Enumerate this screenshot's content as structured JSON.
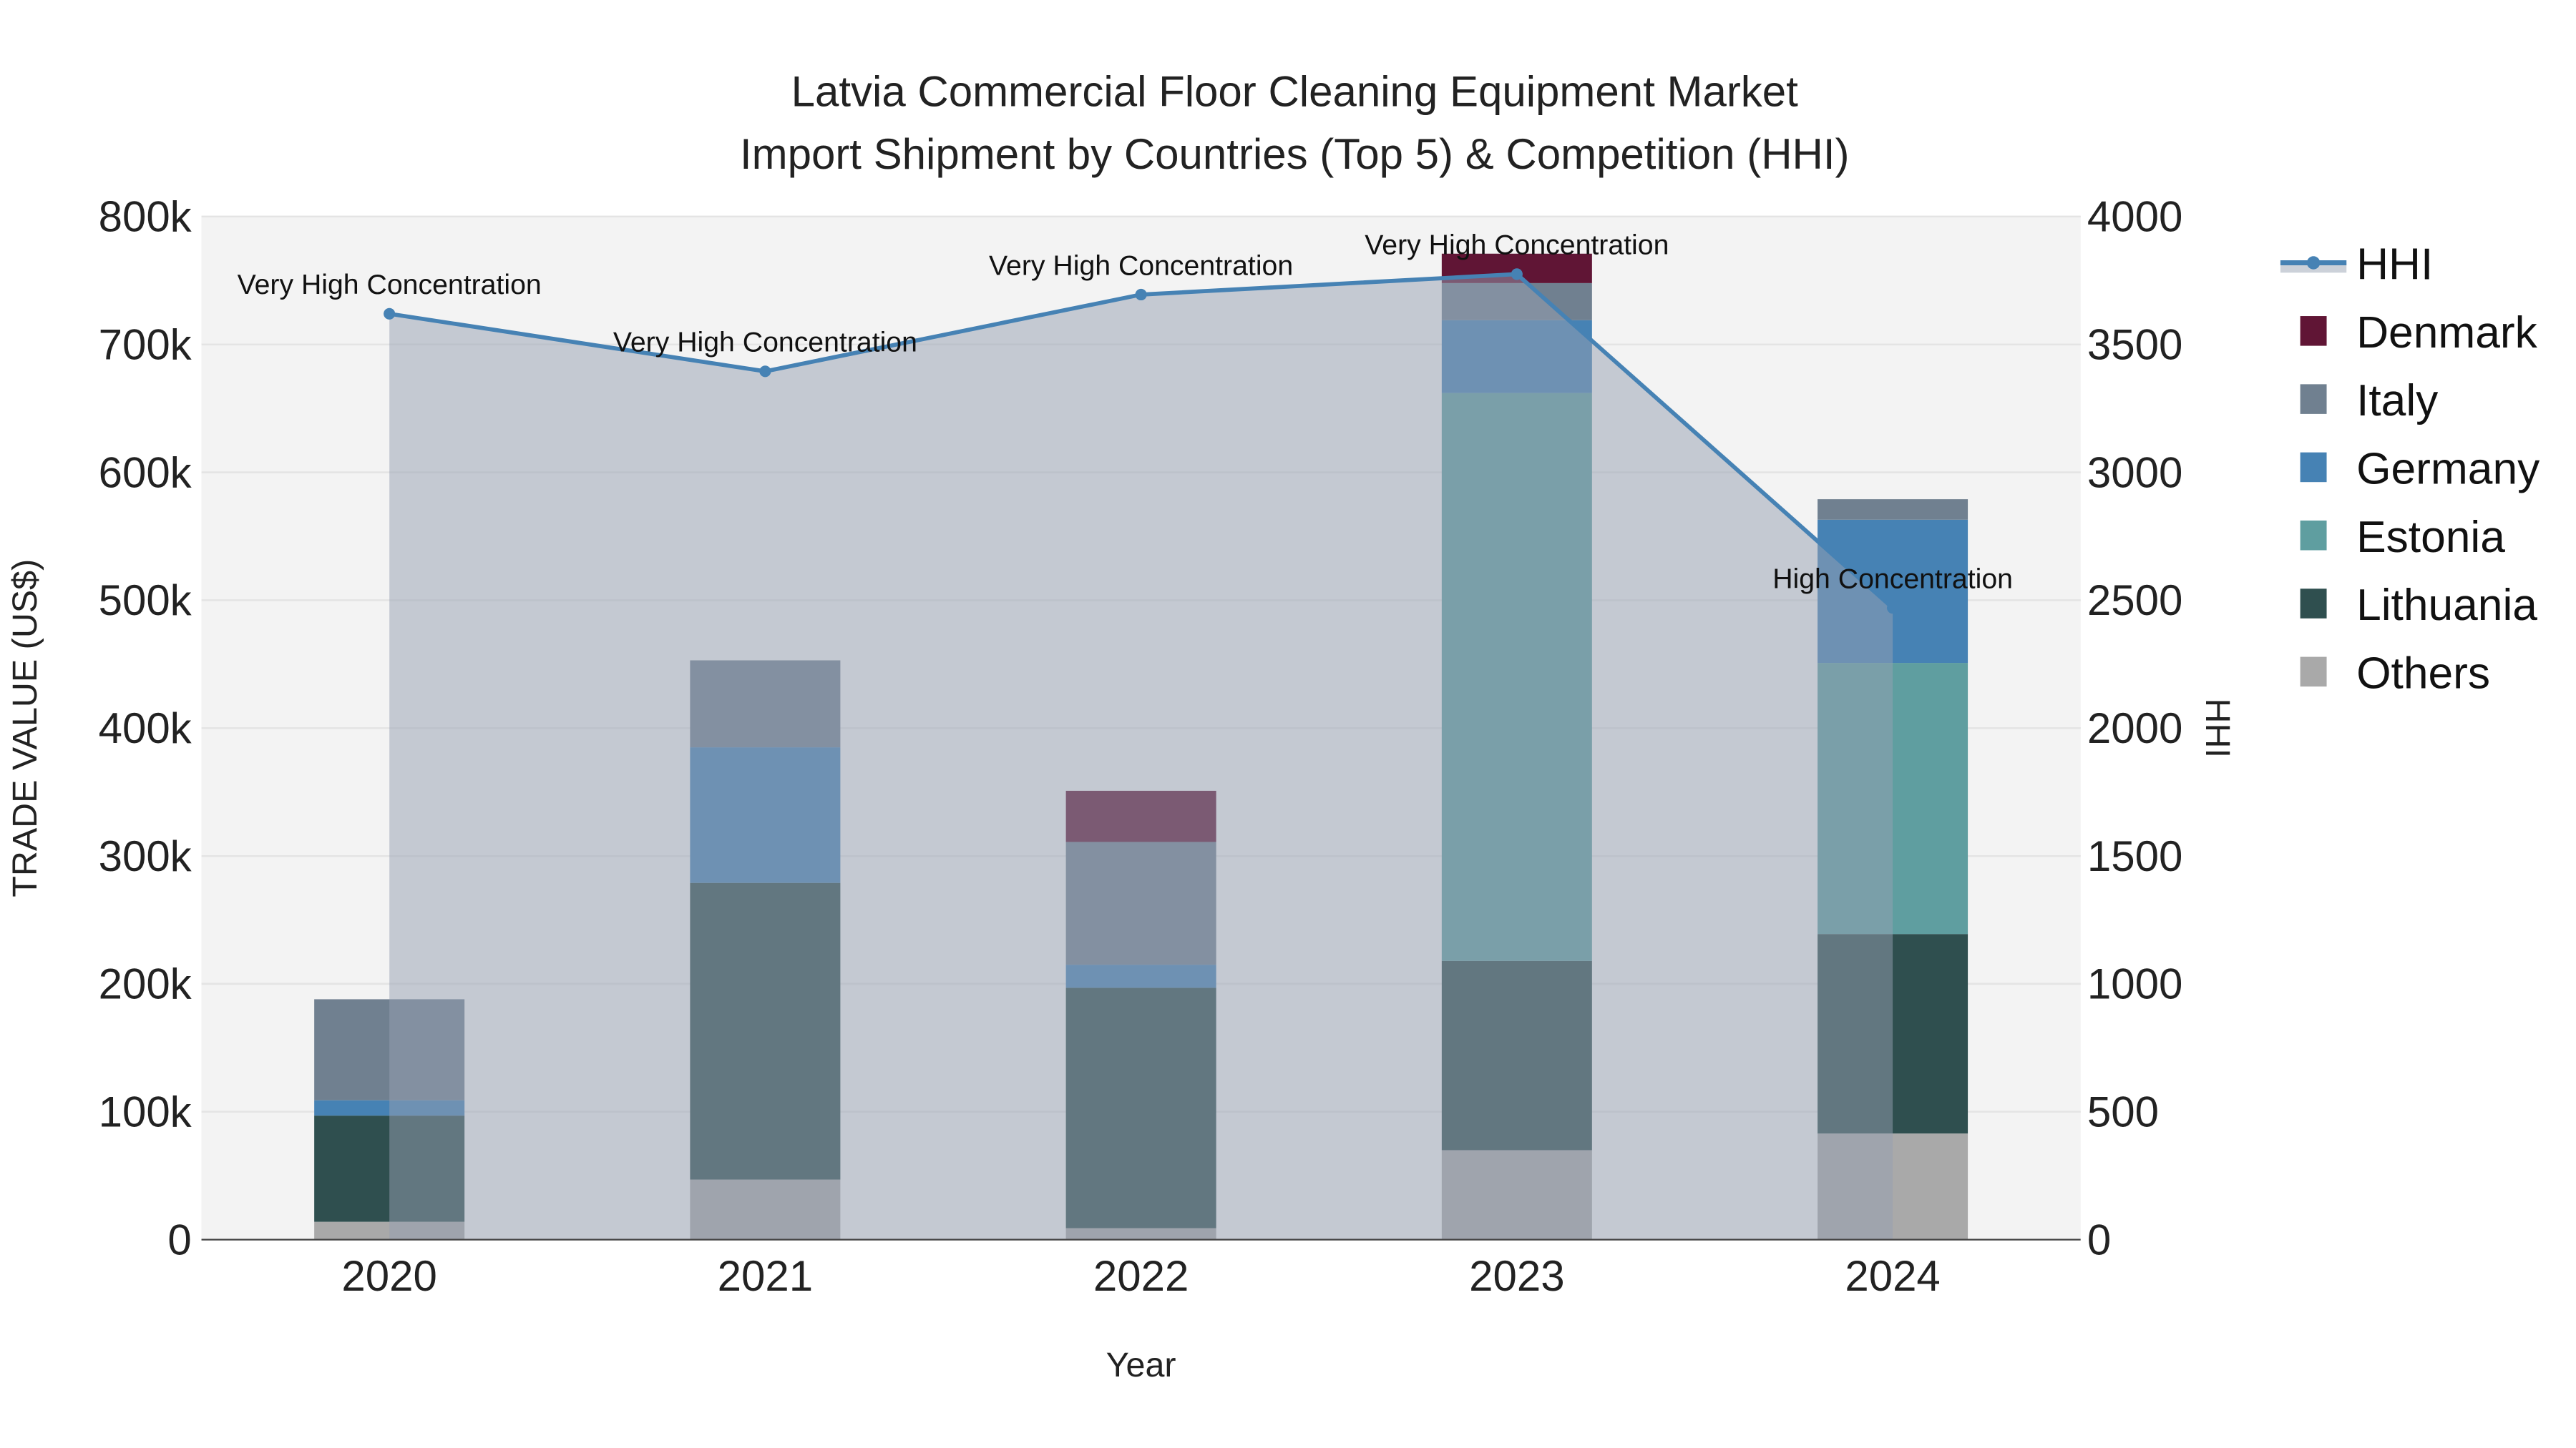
{
  "chart_data": {
    "type": "bar",
    "stacked": true,
    "title": "Latvia Commercial Floor Cleaning Equipment Market",
    "subtitle": "Import Shipment by Countries (Top 5) & Competition (HHI)",
    "xlabel": "Year",
    "ylabel": "TRADE VALUE (US$)",
    "y2label": "HHI",
    "categories": [
      "2020",
      "2021",
      "2022",
      "2023",
      "2024"
    ],
    "ylim": [
      0,
      800000
    ],
    "y2lim": [
      0,
      4000
    ],
    "yticks": [
      0,
      100000,
      200000,
      300000,
      400000,
      500000,
      600000,
      700000,
      800000
    ],
    "ytick_labels": [
      "0",
      "100k",
      "200k",
      "300k",
      "400k",
      "500k",
      "600k",
      "700k",
      "800k"
    ],
    "y2ticks": [
      0,
      500,
      1000,
      1500,
      2000,
      2500,
      3000,
      3500,
      4000
    ],
    "y2tick_labels": [
      "0",
      "500",
      "1000",
      "1500",
      "2000",
      "2500",
      "3000",
      "3500",
      "4000"
    ],
    "series": [
      {
        "name": "Others",
        "color": "#a9a9a9",
        "values": [
          14000,
          47000,
          9000,
          70000,
          83000
        ]
      },
      {
        "name": "Lithuania",
        "color": "#2f4f4f",
        "values": [
          83000,
          232000,
          188000,
          148000,
          156000
        ]
      },
      {
        "name": "Estonia",
        "color": "#5f9ea0",
        "values": [
          0,
          0,
          0,
          444000,
          212000
        ]
      },
      {
        "name": "Germany",
        "color": "#4682b4",
        "values": [
          12000,
          106000,
          18000,
          57000,
          112000
        ]
      },
      {
        "name": "Italy",
        "color": "#708090",
        "values": [
          79000,
          68000,
          96000,
          29000,
          16000
        ]
      },
      {
        "name": "Denmark",
        "color": "#601535",
        "values": [
          0,
          0,
          40000,
          23000,
          0
        ]
      }
    ],
    "hhi": {
      "name": "HHI",
      "color": "#4682b4",
      "values": [
        3620,
        3395,
        3695,
        3775,
        2470
      ],
      "annotations": [
        "Very High Concentration",
        "Very High Concentration",
        "Very High Concentration",
        "Very High Concentration",
        "High Concentration"
      ]
    },
    "legend": {
      "placement": "right",
      "entries": [
        "HHI",
        "Denmark",
        "Italy",
        "Germany",
        "Estonia",
        "Lithuania",
        "Others"
      ]
    },
    "grid": true
  }
}
